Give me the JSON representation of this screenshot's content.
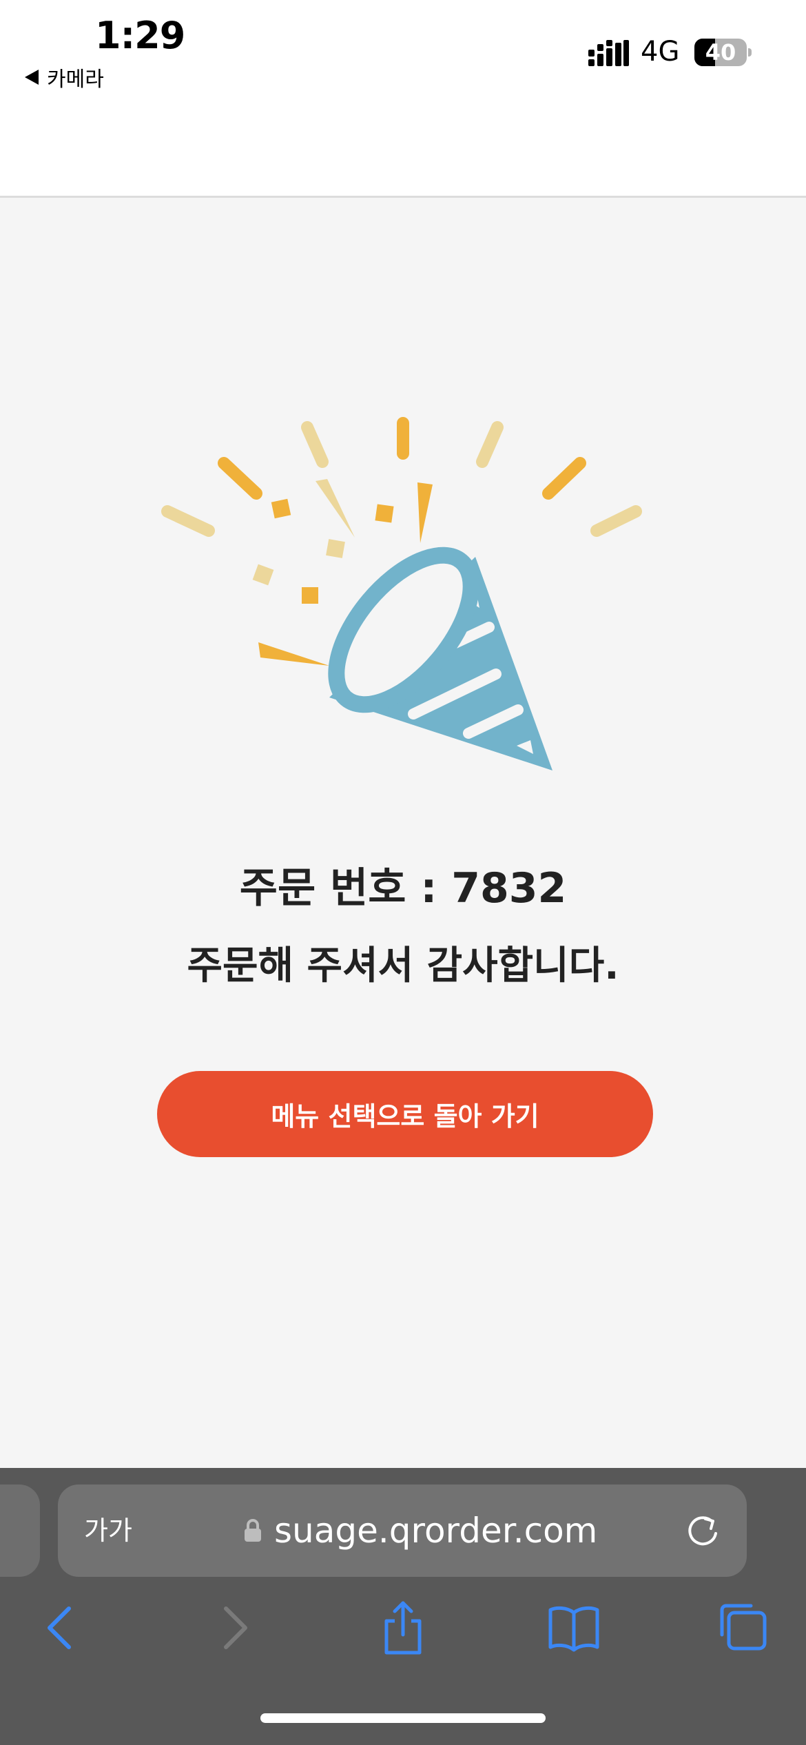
{
  "status_bar": {
    "time": "1:29",
    "back_app": "카메라",
    "network": "4G",
    "battery": "40",
    "battery_level": 0.4
  },
  "order": {
    "label": "주문 번호",
    "separator": " : ",
    "number": "7832",
    "thanks": "주문해 주셔서 감사합니다."
  },
  "button": {
    "label": "메뉴 선택으로 돌아 가기",
    "color": "#e84e2f"
  },
  "safari": {
    "text_size": "가가",
    "url": "suage.qrorder.com"
  },
  "colors": {
    "confetti_yellow": "#f0b13a",
    "confetti_light": "#ecd79b",
    "party_hat": "#72b3cb"
  },
  "icons": {
    "party": "party-popper-icon",
    "lock": "lock-icon",
    "reload": "reload-icon",
    "back": "chevron-left-icon",
    "forward": "chevron-right-icon",
    "share": "share-icon",
    "bookmarks": "book-icon",
    "tabs": "tabs-icon"
  }
}
